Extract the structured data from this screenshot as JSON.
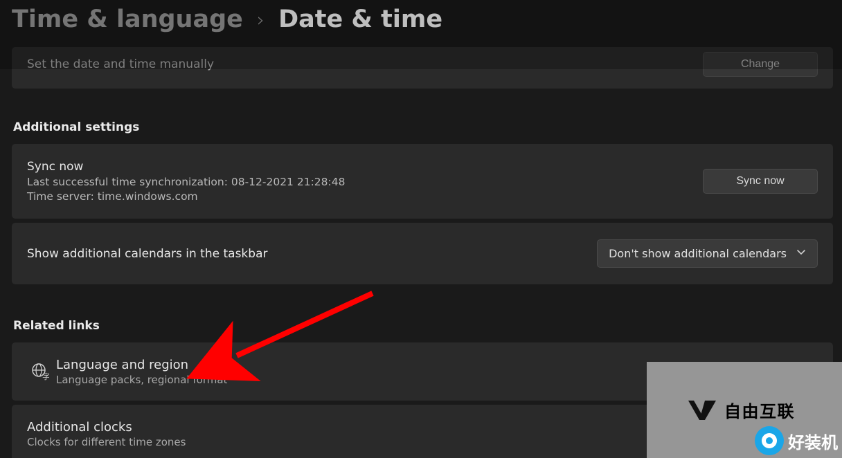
{
  "breadcrumb": {
    "parent": "Time & language",
    "current": "Date & time"
  },
  "manual_row": {
    "label": "Set the date and time manually",
    "button": "Change"
  },
  "additional_settings": {
    "heading": "Additional settings",
    "sync": {
      "title": "Sync now",
      "last_sync": "Last successful time synchronization: 08-12-2021 21:28:48",
      "server": "Time server: time.windows.com",
      "button": "Sync now"
    },
    "calendar": {
      "label": "Show additional calendars in the taskbar",
      "value": "Don't show additional calendars"
    }
  },
  "related_links": {
    "heading": "Related links",
    "language_region": {
      "title": "Language and region",
      "sub": "Language packs, regional format"
    },
    "additional_clocks": {
      "title": "Additional clocks",
      "sub": "Clocks for different time zones"
    }
  },
  "watermarks": {
    "wm1": "自由互联",
    "wm2": "好装机"
  }
}
